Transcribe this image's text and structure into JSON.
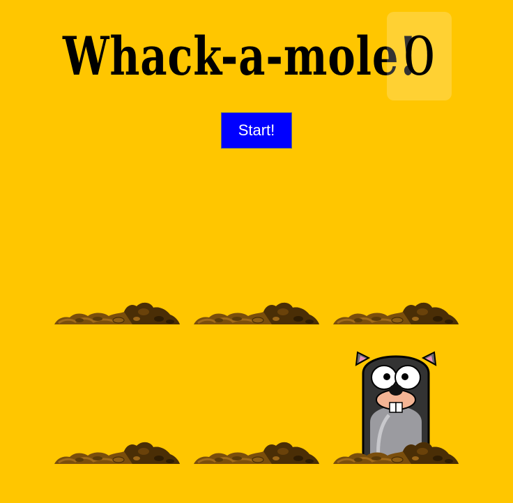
{
  "header": {
    "title": "Whack-a-mole!",
    "score": "0"
  },
  "controls": {
    "start_label": "Start!"
  },
  "board": {
    "holes": [
      {
        "mole_up": false
      },
      {
        "mole_up": false
      },
      {
        "mole_up": false
      },
      {
        "mole_up": false
      },
      {
        "mole_up": false
      },
      {
        "mole_up": true
      }
    ]
  },
  "colors": {
    "background": "#ffc600",
    "start_button": "#0000ff",
    "dirt": "#8b5a0f"
  }
}
